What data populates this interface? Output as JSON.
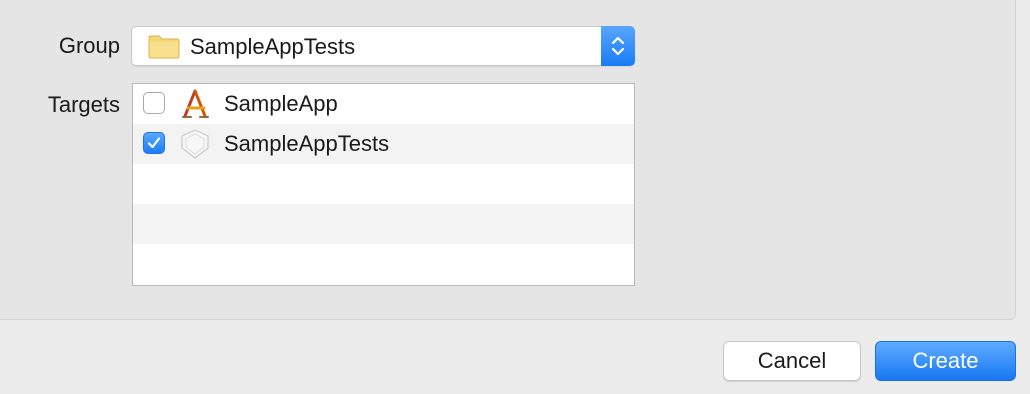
{
  "form": {
    "group_label": "Group",
    "group_value": "SampleAppTests",
    "targets_label": "Targets",
    "targets": [
      {
        "name": "SampleApp",
        "checked": false,
        "icon": "app-target-icon"
      },
      {
        "name": "SampleAppTests",
        "checked": true,
        "icon": "test-bundle-icon"
      }
    ]
  },
  "buttons": {
    "cancel": "Cancel",
    "create": "Create"
  },
  "colors": {
    "accent": "#1a7cf5",
    "panel": "#e5e5e5",
    "window": "#ececec"
  }
}
